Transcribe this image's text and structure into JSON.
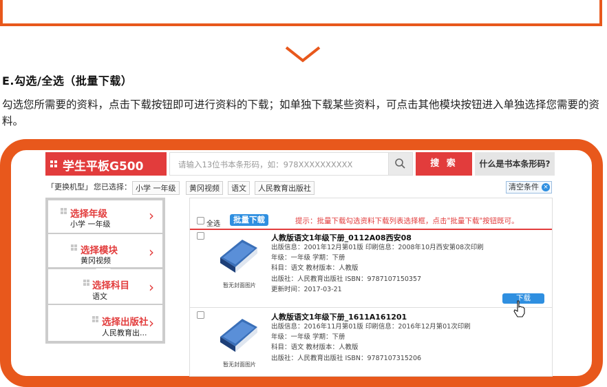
{
  "section": {
    "title": "E.勾选/全选（批量下载）",
    "description": "勾选您所需要的资料，点击下载按钮即可进行资料的下载；如单独下载某些资料，可点击其他模块按钮进入单独选择您需要的资料。"
  },
  "header": {
    "logo": "学生平板G500",
    "search_placeholder": "请输入13位书本条形码，如：978XXXXXXXXXX",
    "search_button": "搜 索",
    "what_is_button": "什么是书本条形码?"
  },
  "filter": {
    "change_model": "「更换机型」",
    "selected_label": "您已选择：",
    "chips": [
      "小学  一年级",
      "黄冈视频",
      "语文",
      "人民教育出版社"
    ],
    "clear_label": "清空条件",
    "clear_icon": "×"
  },
  "sidebar": {
    "items": [
      {
        "title": "选择年级",
        "value": "小学  一年级"
      },
      {
        "title": "选择模块",
        "value": "黄冈视频"
      },
      {
        "title": "选择科目",
        "value": "语文"
      },
      {
        "title": "选择出版社",
        "value": "人民教育出..."
      }
    ]
  },
  "toolbar": {
    "select_all": "全选",
    "batch_download": "批量下载",
    "hint_label": "提示：",
    "hint_text": "批量下载勾选资料下载列表选择框，点击\"批量下载\"按钮既可。"
  },
  "results": [
    {
      "title": "人教版语文1年级下册_0112A08西安08",
      "edition": "出版信息：2001年12月第01版  印刷信息：2008年10月西安第08次印刷",
      "grade": "年级：一年级  学期：下册",
      "subject": "科目：语文  教材版本：人教版",
      "publisher": "出版社：人民教育出版社    ISBN：9787107150357",
      "updated": "更新时间：2017-03-21",
      "no_cover": "暂无封面图片",
      "download": "下载"
    },
    {
      "title": "人教版语文1年级下册_1611A161201",
      "edition": "出版信息：2016年11月第01版  印刷信息：2016年12月第01次印刷",
      "grade": "年级：一年级  学期：下册",
      "subject": "科目：语文  教材版本：人教版",
      "publisher": "出版社：人民教育出版社    ISBN：9787107315206",
      "no_cover": "暂无封面图片"
    }
  ],
  "colors": {
    "accent": "#e8581c",
    "red": "#e23c3c",
    "blue": "#2f8fe0"
  }
}
